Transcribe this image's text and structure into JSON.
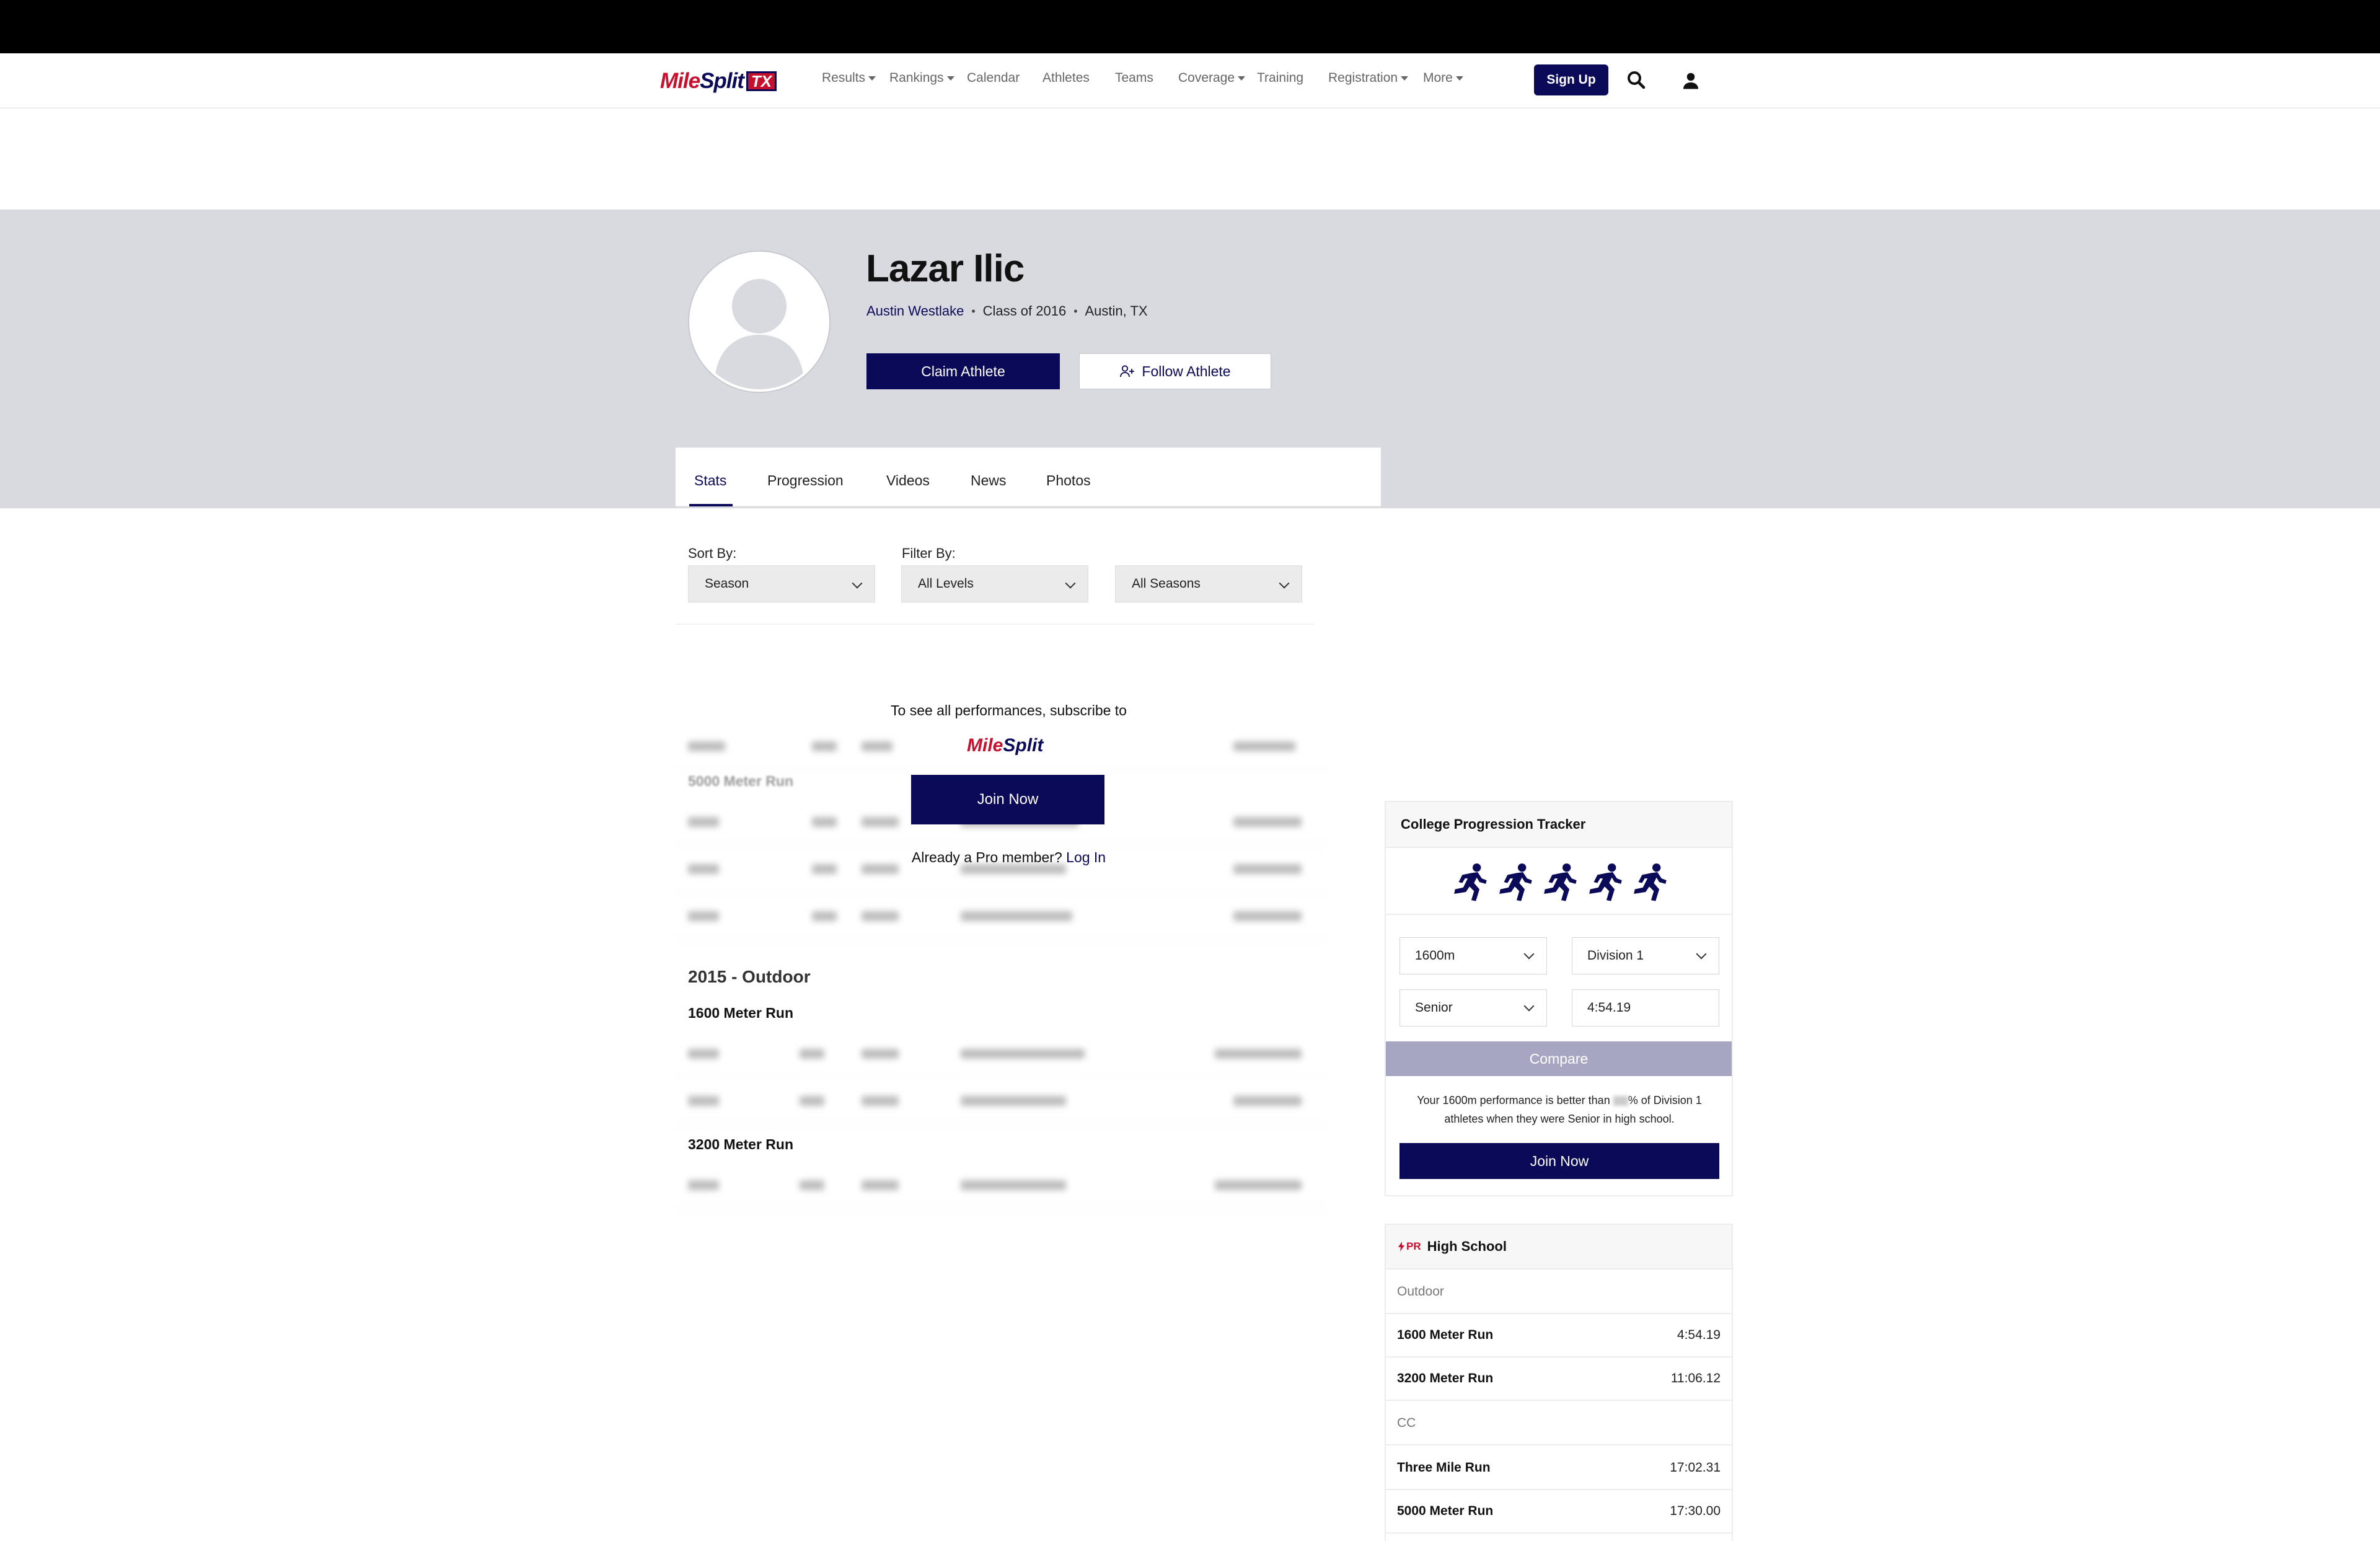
{
  "brand": {
    "logo_mile": "Mile",
    "logo_split": "Split",
    "logo_state": "TX",
    "accent": "#0b0a59",
    "red": "#c8102e"
  },
  "nav": {
    "items": [
      {
        "label": "Results",
        "dropdown": true
      },
      {
        "label": "Rankings",
        "dropdown": true
      },
      {
        "label": "Calendar",
        "dropdown": false
      },
      {
        "label": "Athletes",
        "dropdown": false
      },
      {
        "label": "Teams",
        "dropdown": false
      },
      {
        "label": "Coverage",
        "dropdown": true
      },
      {
        "label": "Training",
        "dropdown": false
      },
      {
        "label": "Registration",
        "dropdown": true
      },
      {
        "label": "More",
        "dropdown": true
      }
    ],
    "signup_label": "Sign Up"
  },
  "athlete": {
    "name": "Lazar Ilic",
    "school": "Austin Westlake",
    "class": "Class of 2016",
    "location": "Austin, TX",
    "claim_label": "Claim Athlete",
    "follow_label": "Follow Athlete"
  },
  "tabs": [
    "Stats",
    "Progression",
    "Videos",
    "News",
    "Photos"
  ],
  "active_tab": "Stats",
  "filters": {
    "sort_label": "Sort By:",
    "filter_label": "Filter By:",
    "sort_value": "Season",
    "level_value": "All Levels",
    "season_value": "All Seasons"
  },
  "paywall": {
    "message": "To see all performances, subscribe to",
    "logo_mile": "Mile",
    "logo_split": "Split",
    "join_label": "Join Now",
    "login_prompt": "Already a Pro member?",
    "login_link": "Log In"
  },
  "performances": {
    "blurred_event": "5000 Meter Run",
    "season": "2015 - Outdoor",
    "events": [
      "1600 Meter Run",
      "3200 Meter Run"
    ]
  },
  "cpt": {
    "title": "College Progression Tracker",
    "event": "1600m",
    "division": "Division 1",
    "grade": "Senior",
    "time": "4:54.19",
    "compare_label": "Compare",
    "note_prefix": "Your 1600m performance is better than",
    "note_suffix": "% of Division 1 athletes when they were Senior in high school.",
    "join_label": "Join Now",
    "runner_icon": "runner-icon"
  },
  "prs": {
    "badge": "PR",
    "title": "High School",
    "sections": [
      {
        "name": "Outdoor",
        "rows": [
          {
            "event": "1600 Meter Run",
            "time": "4:54.19"
          },
          {
            "event": "3200 Meter Run",
            "time": "11:06.12"
          }
        ]
      },
      {
        "name": "CC",
        "rows": [
          {
            "event": "Three Mile Run",
            "time": "17:02.31"
          },
          {
            "event": "5000 Meter Run",
            "time": "17:30.00"
          }
        ]
      }
    ]
  }
}
